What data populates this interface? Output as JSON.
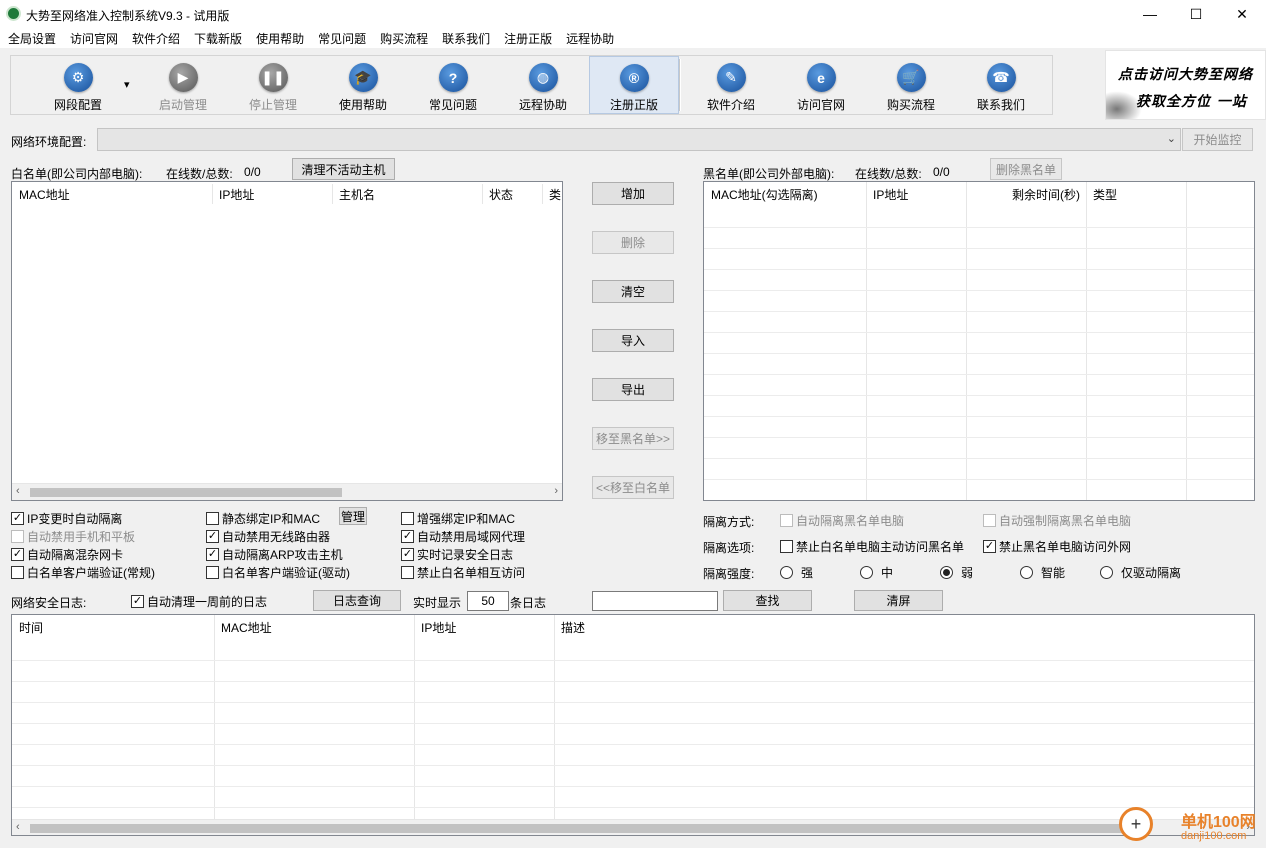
{
  "window": {
    "title": "大势至网络准入控制系统V9.3 - 试用版",
    "minimize": "—",
    "maximize": "☐",
    "close": "✕"
  },
  "menu": [
    "全局设置",
    "访问官网",
    "软件介绍",
    "下载新版",
    "使用帮助",
    "常见问题",
    "购买流程",
    "联系我们",
    "注册正版",
    "远程协助"
  ],
  "toolbar": [
    {
      "label": "网段配置",
      "icon": "gear-icon",
      "glyph": "⚙",
      "disabled": false,
      "dropdown": "▾"
    },
    {
      "label": "启动管理",
      "icon": "play-icon",
      "glyph": "▶",
      "disabled": true
    },
    {
      "label": "停止管理",
      "icon": "pause-icon",
      "glyph": "❚❚",
      "disabled": true
    },
    {
      "label": "使用帮助",
      "icon": "graduation-cap-icon",
      "glyph": "🎓",
      "disabled": false
    },
    {
      "label": "常见问题",
      "icon": "question-icon",
      "glyph": "?",
      "disabled": false
    },
    {
      "label": "远程协助",
      "icon": "globe-icon",
      "glyph": "◍",
      "disabled": false
    },
    {
      "label": "注册正版",
      "icon": "registered-icon",
      "glyph": "®",
      "disabled": false,
      "selected": true
    },
    {
      "label": "软件介绍",
      "icon": "document-edit-icon",
      "glyph": "✎",
      "disabled": false
    },
    {
      "label": "访问官网",
      "icon": "ie-browser-icon",
      "glyph": "e",
      "disabled": false
    },
    {
      "label": "购买流程",
      "icon": "cart-icon",
      "glyph": "🛒",
      "disabled": false
    },
    {
      "label": "联系我们",
      "icon": "phone-icon",
      "glyph": "☎",
      "disabled": false
    }
  ],
  "banner": {
    "line1": "点击访问大势至网络",
    "line2": "获取全方位 一站"
  },
  "env": {
    "label": "网络环境配置:",
    "value": "",
    "start_button": "开始监控"
  },
  "whitelist": {
    "title": "白名单(即公司内部电脑):",
    "count_label": "在线数/总数:",
    "count_value": "0/0",
    "clean_button": "清理不活动主机",
    "columns": [
      "MAC地址",
      "IP地址",
      "主机名",
      "状态",
      "类"
    ]
  },
  "blacklist": {
    "title": "黑名单(即公司外部电脑):",
    "count_label": "在线数/总数:",
    "count_value": "0/0",
    "delete_button": "删除黑名单",
    "columns": [
      "MAC地址(勾选隔离)",
      "IP地址",
      "剩余时间(秒)",
      "类型"
    ]
  },
  "actions": {
    "add": "增加",
    "delete": "删除",
    "clear": "清空",
    "import": "导入",
    "export": "导出",
    "to_black": "移至黑名单>>",
    "to_white": "<<移至白名单"
  },
  "options": [
    {
      "label": "IP变更时自动隔离",
      "checked": true,
      "disabled": false
    },
    {
      "label": "静态绑定IP和MAC",
      "checked": false,
      "disabled": false
    },
    {
      "label": "增强绑定IP和MAC",
      "checked": false,
      "disabled": false
    },
    {
      "label": "自动禁用手机和平板",
      "checked": false,
      "disabled": true
    },
    {
      "label": "自动禁用无线路由器",
      "checked": true,
      "disabled": false
    },
    {
      "label": "自动禁用局域网代理",
      "checked": true,
      "disabled": false
    },
    {
      "label": "自动隔离混杂网卡",
      "checked": true,
      "disabled": false
    },
    {
      "label": "自动隔离ARP攻击主机",
      "checked": true,
      "disabled": false
    },
    {
      "label": "实时记录安全日志",
      "checked": true,
      "disabled": false
    },
    {
      "label": "白名单客户端验证(常规)",
      "checked": false,
      "disabled": false
    },
    {
      "label": "白名单客户端验证(驱动)",
      "checked": false,
      "disabled": false
    },
    {
      "label": "禁止白名单相互访问",
      "checked": false,
      "disabled": false
    }
  ],
  "manage_button": "管理",
  "isolation": {
    "mode_label": "隔离方式:",
    "mode_options": [
      {
        "label": "自动隔离黑名单电脑",
        "checked": false,
        "disabled": true
      },
      {
        "label": "自动强制隔离黑名单电脑",
        "checked": false,
        "disabled": true
      }
    ],
    "option_label": "隔离选项:",
    "option_options": [
      {
        "label": "禁止白名单电脑主动访问黑名单",
        "checked": false,
        "disabled": false
      },
      {
        "label": "禁止黑名单电脑访问外网",
        "checked": true,
        "disabled": false
      }
    ],
    "strength_label": "隔离强度:",
    "strength_options": [
      {
        "label": "强",
        "selected": false
      },
      {
        "label": "中",
        "selected": false
      },
      {
        "label": "弱",
        "selected": true
      },
      {
        "label": "智能",
        "selected": false
      },
      {
        "label": "仅驱动隔离",
        "selected": false
      }
    ]
  },
  "log": {
    "label": "网络安全日志:",
    "auto_clean": {
      "label": "自动清理一周前的日志",
      "checked": true
    },
    "query_button": "日志查询",
    "realtime_label": "实时显示",
    "realtime_value": "50",
    "realtime_suffix": "条日志",
    "search_value": "",
    "find_button": "查找",
    "clear_button": "清屏",
    "columns": [
      "时间",
      "MAC地址",
      "IP地址",
      "描述"
    ]
  },
  "watermark": {
    "name": "单机100网",
    "site": "danji100.com",
    "glyph": "+"
  }
}
